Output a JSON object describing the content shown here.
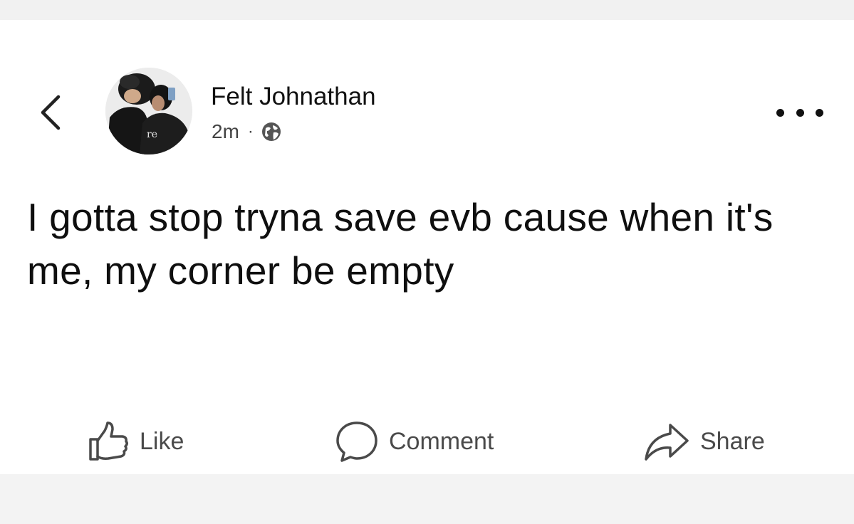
{
  "post": {
    "author": "Felt Johnathan",
    "time": "2m",
    "separator": "·",
    "audience_icon": "globe-icon",
    "text": "I gotta stop tryna save evb cause when it's me, my corner be empty",
    "avatar_caption": "re"
  },
  "header": {
    "back_icon": "chevron-left-icon",
    "more_icon": "more-horizontal-icon"
  },
  "actions": {
    "like": {
      "label": "Like",
      "icon": "thumbs-up-icon"
    },
    "comment": {
      "label": "Comment",
      "icon": "comment-bubble-icon"
    },
    "share": {
      "label": "Share",
      "icon": "share-arrow-icon"
    }
  },
  "colors": {
    "page_background": "#f5f5f5",
    "card_background": "#ffffff",
    "text_primary": "#111111",
    "text_secondary": "#4a4a4a"
  }
}
